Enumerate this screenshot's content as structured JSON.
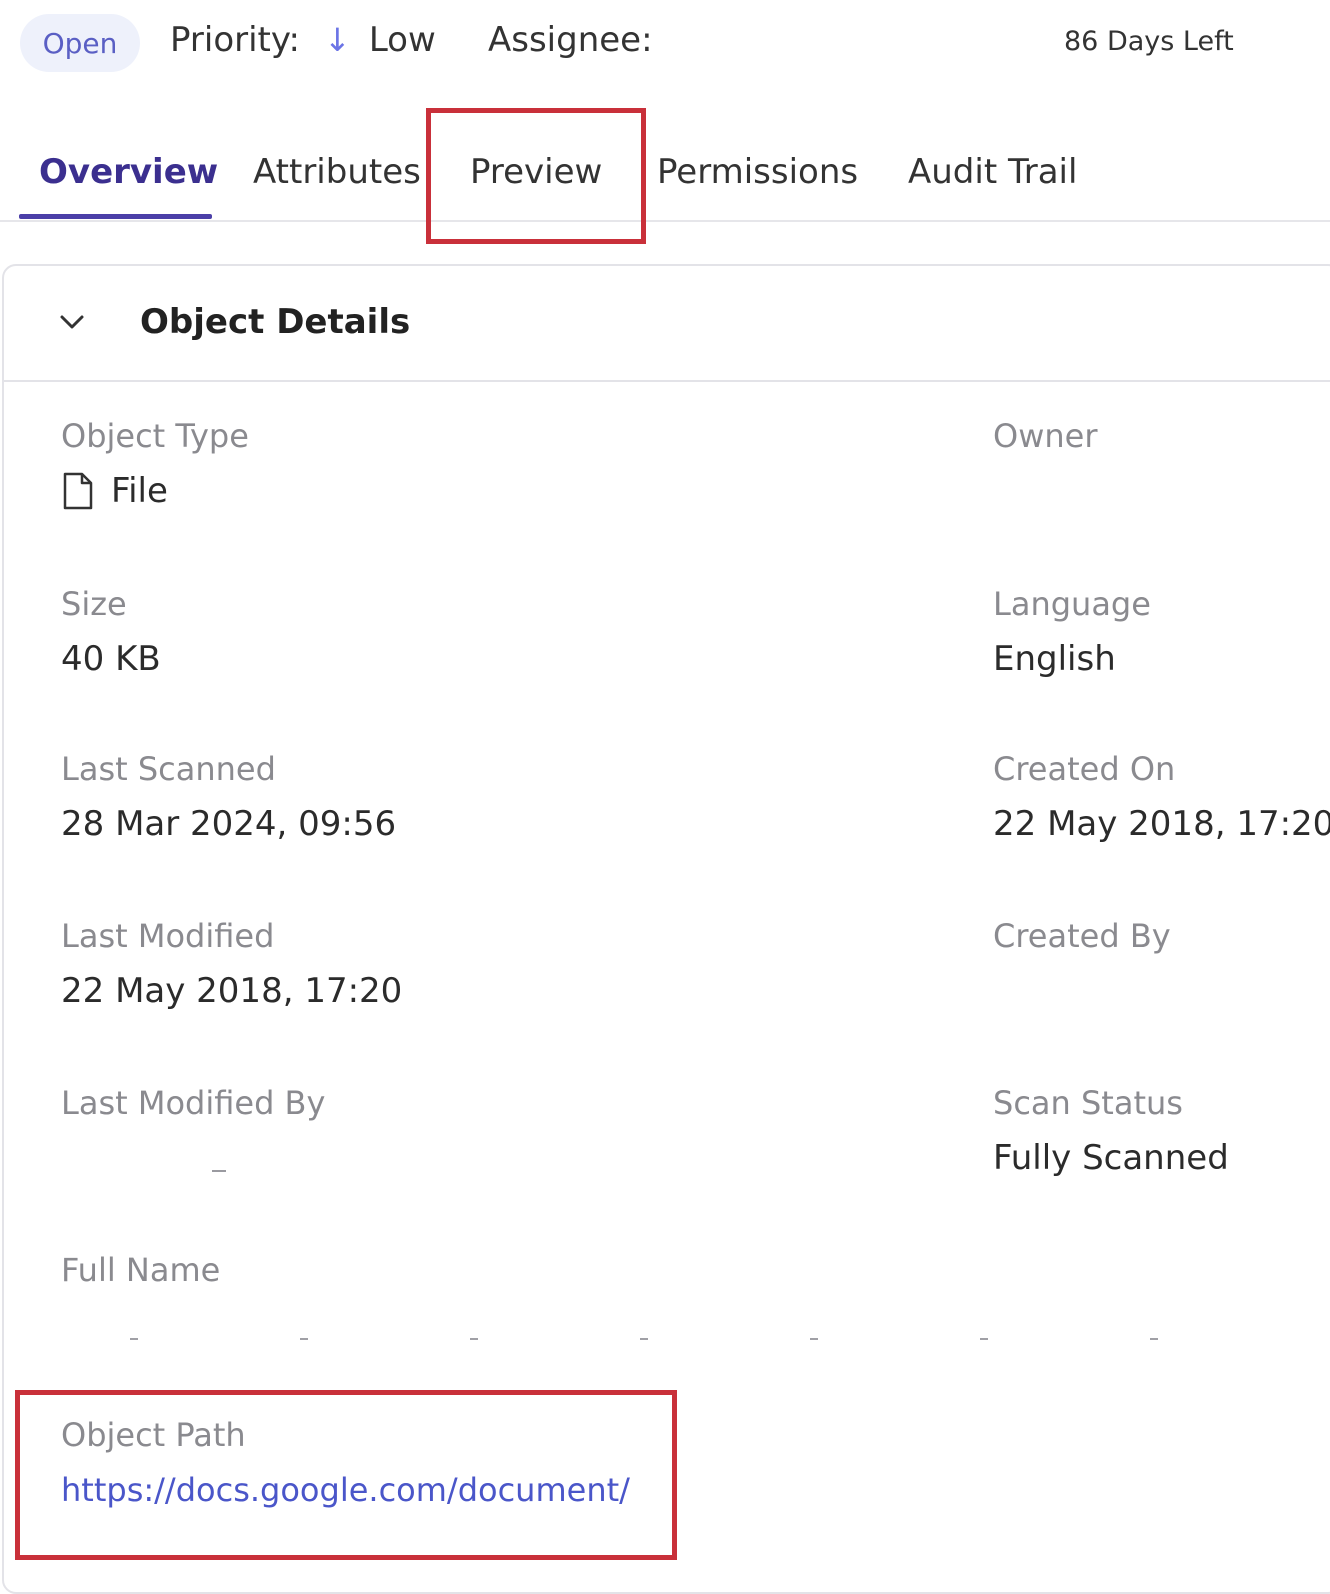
{
  "header": {
    "status": "Open",
    "priority_label": "Priority:",
    "priority_arrow": "↓",
    "priority_value": "Low",
    "assignee_label": "Assignee:",
    "days_left": "86 Days Left"
  },
  "tabs": [
    {
      "label": "Overview",
      "active": true
    },
    {
      "label": "Attributes",
      "active": false
    },
    {
      "label": "Preview",
      "active": false
    },
    {
      "label": "Permissions",
      "active": false
    },
    {
      "label": "Audit Trail",
      "active": false
    }
  ],
  "details": {
    "section_title": "Object Details",
    "object_type_label": "Object Type",
    "object_type_value": "File",
    "owner_label": "Owner",
    "size_label": "Size",
    "size_value": "40 KB",
    "language_label": "Language",
    "language_value": "English",
    "last_scanned_label": "Last Scanned",
    "last_scanned_value": "28 Mar 2024, 09:56",
    "created_on_label": "Created On",
    "created_on_value": "22 May 2018, 17:20",
    "last_modified_label": "Last Modified",
    "last_modified_value": "22 May 2018, 17:20",
    "created_by_label": "Created By",
    "last_modified_by_label": "Last Modified By",
    "scan_status_label": "Scan Status",
    "scan_status_value": "Fully Scanned",
    "full_name_label": "Full Name",
    "object_path_label": "Object Path",
    "object_path_value": "https://docs.google.com/document/"
  },
  "colors": {
    "accent": "#4b3fa8",
    "highlight": "#c9303a",
    "link": "#4a56c9"
  }
}
